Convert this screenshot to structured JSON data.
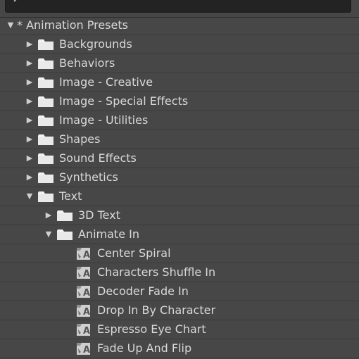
{
  "tree": {
    "root": {
      "label": "* Animation Presets",
      "expanded": true
    },
    "categories": [
      {
        "label": "Backgrounds"
      },
      {
        "label": "Behaviors"
      },
      {
        "label": "Image - Creative"
      },
      {
        "label": "Image - Special Effects"
      },
      {
        "label": "Image - Utilities"
      },
      {
        "label": "Shapes"
      },
      {
        "label": "Sound Effects"
      },
      {
        "label": "Synthetics"
      }
    ],
    "text_folder": {
      "label": "Text",
      "expanded": true
    },
    "text_children": [
      {
        "label": "3D Text",
        "expanded": false
      },
      {
        "label": "Animate In",
        "expanded": true
      }
    ],
    "animate_in_presets": [
      {
        "label": "Center Spiral"
      },
      {
        "label": "Characters Shuffle In"
      },
      {
        "label": "Decoder Fade In"
      },
      {
        "label": "Drop In By Character"
      },
      {
        "label": "Espresso Eye Chart"
      },
      {
        "label": "Fade Up And Flip"
      }
    ]
  },
  "icons": {
    "search": "search-icon",
    "folder": "folder-icon",
    "preset": "preset-icon",
    "expanded": "triangle-down-icon",
    "collapsed": "triangle-right-icon"
  },
  "colors": {
    "panel_bg": "#474747",
    "search_bg": "#232323",
    "text": "#d9d9d9",
    "folder": "#f2f2f2"
  }
}
